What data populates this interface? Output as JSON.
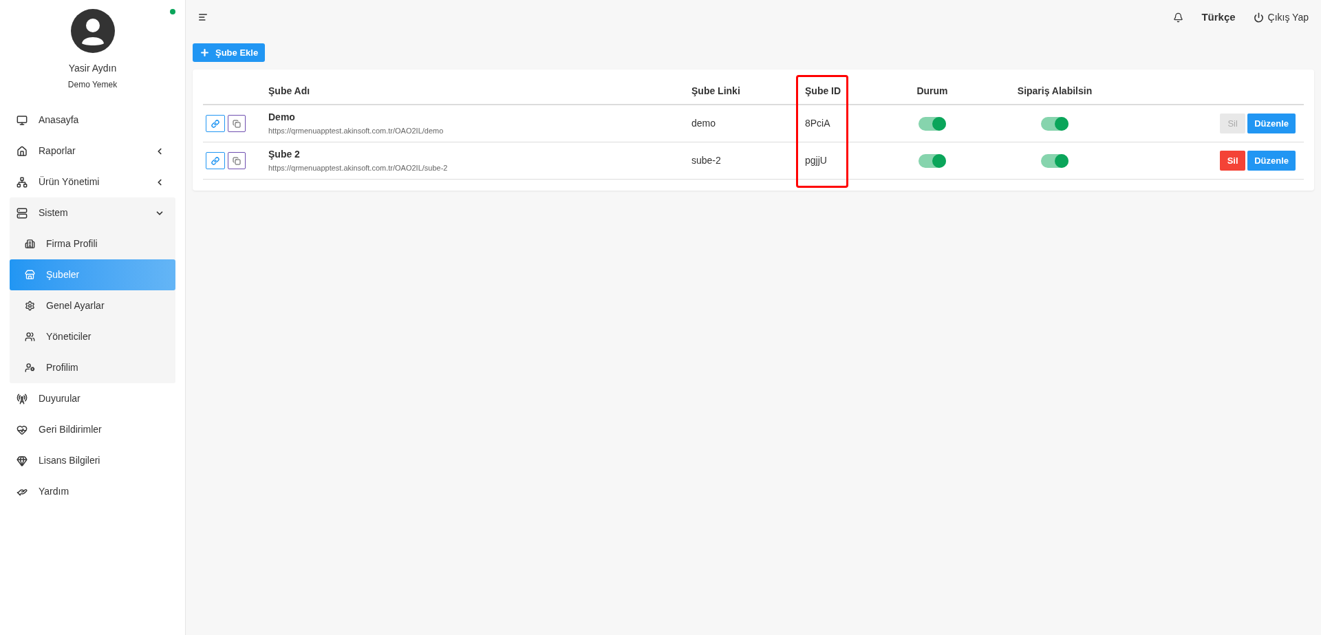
{
  "sidebar": {
    "user": {
      "name": "Yasir Aydın",
      "company": "Demo Yemek",
      "online": true
    },
    "items": [
      {
        "label": "Anasayfa",
        "kind": "link",
        "selected": false
      },
      {
        "label": "Raporlar",
        "kind": "group",
        "expanded": false
      },
      {
        "label": "Ürün Yönetimi",
        "kind": "group",
        "expanded": false
      },
      {
        "label": "Sistem",
        "kind": "group",
        "expanded": true,
        "children": [
          {
            "label": "Firma Profili",
            "selected": false
          },
          {
            "label": "Şubeler",
            "selected": true
          },
          {
            "label": "Genel Ayarlar",
            "selected": false
          },
          {
            "label": "Yöneticiler",
            "selected": false
          },
          {
            "label": "Profilim",
            "selected": false
          }
        ]
      },
      {
        "label": "Duyurular",
        "kind": "link",
        "selected": false
      },
      {
        "label": "Geri Bildirimler",
        "kind": "link",
        "selected": false
      },
      {
        "label": "Lisans Bilgileri",
        "kind": "link",
        "selected": false
      },
      {
        "label": "Yardım",
        "kind": "link",
        "selected": false
      }
    ]
  },
  "topbar": {
    "language": "Türkçe",
    "logout": "Çıkış Yap"
  },
  "add_button": "Şube Ekle",
  "table": {
    "columns": [
      {
        "label": "Şube Adı",
        "highlighted": false
      },
      {
        "label": "Şube Linki",
        "highlighted": false
      },
      {
        "label": "Şube ID",
        "highlighted": true
      },
      {
        "label": "Durum",
        "highlighted": false
      },
      {
        "label": "Sipariş Alabilsin",
        "highlighted": false
      }
    ],
    "rows": [
      {
        "name": "Demo",
        "url": "https://qrmenuapptest.akinsoft.com.tr/OAO2IL/demo",
        "link": "demo",
        "id": "8PciA",
        "status_on": true,
        "order_on": true,
        "delete_label": "Sil",
        "delete_disabled": true,
        "edit_label": "Düzenle"
      },
      {
        "name": "Şube 2",
        "url": "https://qrmenuapptest.akinsoft.com.tr/OAO2IL/sube-2",
        "link": "sube-2",
        "id": "pgjjU",
        "status_on": true,
        "order_on": true,
        "delete_label": "Sil",
        "delete_disabled": false,
        "edit_label": "Düzenle"
      }
    ]
  }
}
